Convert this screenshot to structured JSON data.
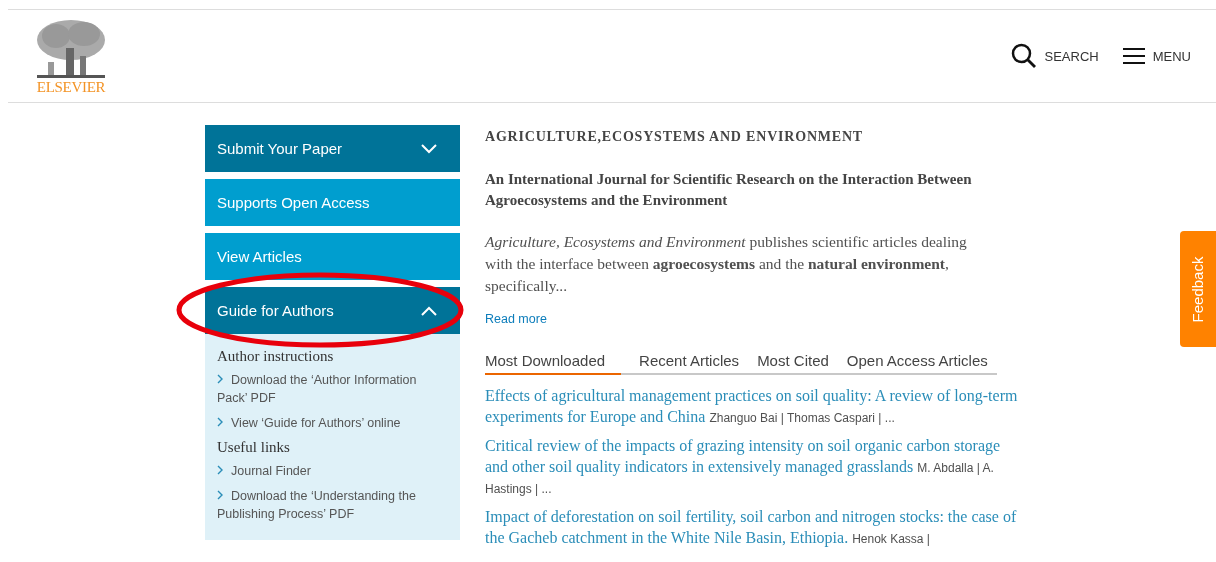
{
  "header": {
    "logo_text": "ELSEVIER",
    "actions": [
      {
        "kind": "search",
        "label": "SEARCH"
      },
      {
        "kind": "menu",
        "label": "MENU"
      }
    ]
  },
  "sidebar": {
    "items": [
      {
        "label": "Submit Your Paper",
        "kind": "accordion",
        "expanded": false,
        "circled": false
      },
      {
        "label": "Supports Open Access",
        "kind": "link",
        "circled": false
      },
      {
        "label": "View Articles",
        "kind": "link",
        "circled": false
      },
      {
        "label": "Guide for Authors",
        "kind": "accordion",
        "expanded": true,
        "circled": true,
        "sections": [
          {
            "heading": "Author instructions",
            "links": [
              "Download the ‘Author Information Pack’ PDF",
              "View ‘Guide for Authors’ online"
            ]
          },
          {
            "heading": "Useful links",
            "links": [
              "Journal Finder",
              "Download the ‘Understanding the Publishing Process’ PDF"
            ]
          }
        ]
      }
    ]
  },
  "journal": {
    "title": "AGRICULTURE,ECOSYSTEMS AND ENVIRONMENT",
    "subtitle": "An International Journal for Scientific Research on the Interaction Between Agroecosystems and the Environment",
    "description": "*Agriculture, Ecosystems and Environment* publishes scientific articles dealing with the interface between **agroecosystems** and the **natural environment**, specifically...",
    "read_more": "Read more"
  },
  "tabs": [
    {
      "label": "Most Downloaded",
      "selected": true
    },
    {
      "label": "Recent Articles",
      "selected": false
    },
    {
      "label": "Most Cited",
      "selected": false
    },
    {
      "label": "Open Access Articles",
      "selected": false
    }
  ],
  "articles": [
    {
      "title": "Effects of agricultural management practices on soil quality: A review of long-term experiments for Europe and China",
      "authors": "Zhanguo Bai | Thomas Caspari | ..."
    },
    {
      "title": "Critical review of the impacts of grazing intensity on soil organic carbon storage and other soil quality indicators in extensively managed grasslands",
      "authors": "M. Abdalla | A. Hastings | ..."
    },
    {
      "title": "Impact of deforestation on soil fertility, soil carbon and nitrogen stocks: the case of the Gacheb catchment in the White Nile Basin, Ethiopia.",
      "authors": "Henok Kassa |"
    }
  ],
  "feedback": {
    "label": "Feedback"
  }
}
